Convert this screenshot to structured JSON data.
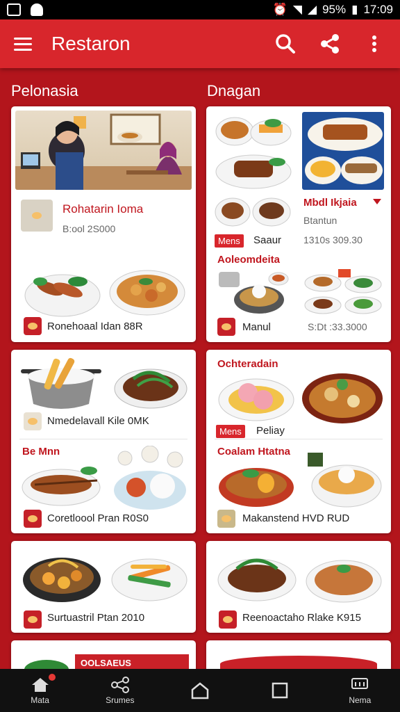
{
  "status": {
    "battery": "95%",
    "time": "17:09"
  },
  "appbar": {
    "title": "Restaron"
  },
  "sections": {
    "left": "Pelonasia",
    "right": "Dnagan"
  },
  "cards": {
    "c1": {
      "title": "Rohatarin Ioma",
      "subtitle": "B:ool 2S000",
      "footer": "Ronehoaal Idan 88R"
    },
    "c2": {
      "title": "Mbdl Ikjaia",
      "subtitle": "Btantun",
      "badge": "Mens",
      "badge_text": "Saaur",
      "price": "1310s 309.30",
      "section2": "Aoleomdeita",
      "footer": "Manul",
      "footer_price": "S:Dt :33.3000"
    },
    "c3": {
      "caption1": "Nmedelavall Kile 0MK",
      "section2": "Be Mnn",
      "caption2": "Coretloool Pran R0S0"
    },
    "c4": {
      "title": "Ochteradain",
      "badge": "Mens",
      "badge_text": "Peliay",
      "section2": "Coalam Htatna",
      "caption2": "Makanstend HVD RUD"
    },
    "c5": {
      "caption": "Surtuastril Ptan 2010"
    },
    "c6": {
      "caption": "Reenoactaho Rlake K915"
    },
    "c7": {
      "label": "OOLSAEUS"
    }
  },
  "nav": [
    {
      "label": "Mata",
      "icon": "home-icon"
    },
    {
      "label": "Srumes",
      "icon": "share-icon"
    },
    {
      "label": "",
      "icon": "home-outline-icon"
    },
    {
      "label": "",
      "icon": "square-icon"
    },
    {
      "label": "Nema",
      "icon": "menu-icon"
    }
  ],
  "colors": {
    "primary": "#d8262c",
    "background": "#b3151c",
    "accent_text": "#c0161e"
  }
}
